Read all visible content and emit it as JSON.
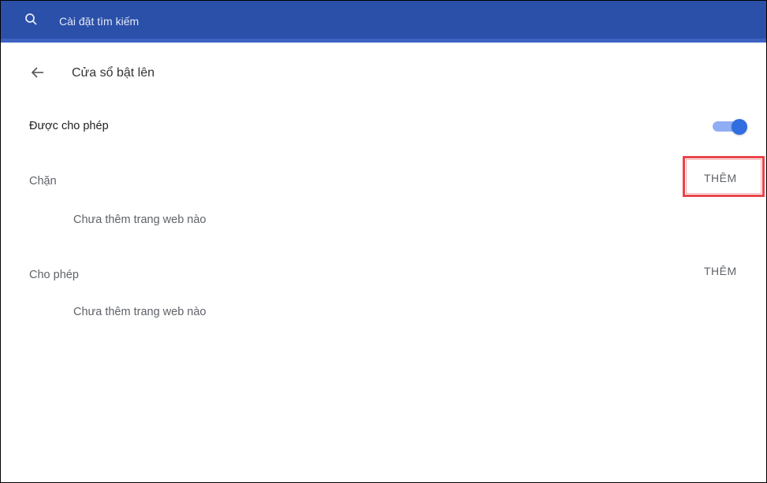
{
  "search": {
    "placeholder": "Cài đặt tìm kiếm",
    "icon": "search-icon"
  },
  "header": {
    "back_icon": "arrow-left-icon",
    "title": "Cửa sổ bật lên"
  },
  "allowed_setting": {
    "label": "Được cho phép",
    "enabled": true
  },
  "blocked_section": {
    "title": "Chặn",
    "add_label": "THÊM",
    "empty_text": "Chưa thêm trang web nào",
    "highlighted": true
  },
  "allow_section": {
    "title": "Cho phép",
    "add_label": "THÊM",
    "empty_text": "Chưa thêm trang web nào"
  },
  "colors": {
    "header_bar": "#2b50a9",
    "toggle_on": "#2f6de1",
    "highlight": "#e8464a"
  }
}
